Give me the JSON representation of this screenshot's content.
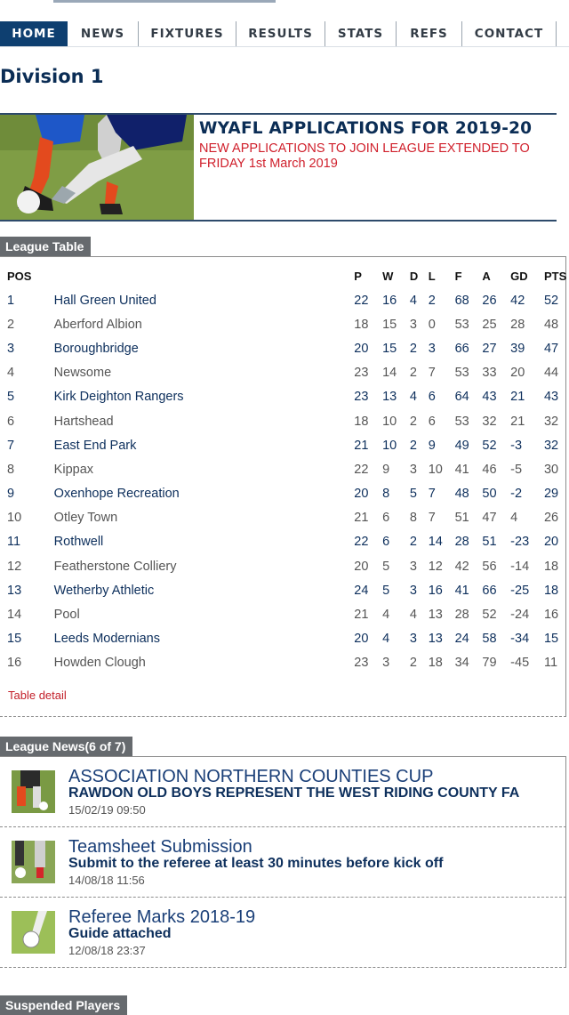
{
  "nav": {
    "items": [
      {
        "label": "HOME",
        "active": true
      },
      {
        "label": "NEWS"
      },
      {
        "label": "FIXTURES"
      },
      {
        "label": "RESULTS"
      },
      {
        "label": "STATS"
      },
      {
        "label": "REFS"
      },
      {
        "label": "CONTACT"
      }
    ]
  },
  "page": {
    "title": "Division 1"
  },
  "banner": {
    "headline": "WYAFL APPLICATIONS FOR 2019-20",
    "subtext": "NEW APPLICATIONS TO JOIN LEAGUE EXTENDED TO FRIDAY 1st March 2019"
  },
  "league_table": {
    "tab_label": "League Table",
    "headers": [
      "POS",
      "",
      "P",
      "W",
      "D",
      "L",
      "F",
      "A",
      "GD",
      "PTS"
    ],
    "rows": [
      [
        "1",
        "Hall Green United",
        "22",
        "16",
        "4",
        "2",
        "68",
        "26",
        "42",
        "52"
      ],
      [
        "2",
        "Aberford Albion",
        "18",
        "15",
        "3",
        "0",
        "53",
        "25",
        "28",
        "48"
      ],
      [
        "3",
        "Boroughbridge",
        "20",
        "15",
        "2",
        "3",
        "66",
        "27",
        "39",
        "47"
      ],
      [
        "4",
        "Newsome",
        "23",
        "14",
        "2",
        "7",
        "53",
        "33",
        "20",
        "44"
      ],
      [
        "5",
        "Kirk Deighton Rangers",
        "23",
        "13",
        "4",
        "6",
        "64",
        "43",
        "21",
        "43"
      ],
      [
        "6",
        "Hartshead",
        "18",
        "10",
        "2",
        "6",
        "53",
        "32",
        "21",
        "32"
      ],
      [
        "7",
        "East End Park",
        "21",
        "10",
        "2",
        "9",
        "49",
        "52",
        "-3",
        "32"
      ],
      [
        "8",
        "Kippax",
        "22",
        "9",
        "3",
        "10",
        "41",
        "46",
        "-5",
        "30"
      ],
      [
        "9",
        "Oxenhope Recreation",
        "20",
        "8",
        "5",
        "7",
        "48",
        "50",
        "-2",
        "29"
      ],
      [
        "10",
        "Otley Town",
        "21",
        "6",
        "8",
        "7",
        "51",
        "47",
        "4",
        "26"
      ],
      [
        "11",
        "Rothwell",
        "22",
        "6",
        "2",
        "14",
        "28",
        "51",
        "-23",
        "20"
      ],
      [
        "12",
        "Featherstone Colliery",
        "20",
        "5",
        "3",
        "12",
        "42",
        "56",
        "-14",
        "18"
      ],
      [
        "13",
        "Wetherby Athletic",
        "24",
        "5",
        "3",
        "16",
        "41",
        "66",
        "-25",
        "18"
      ],
      [
        "14",
        "Pool",
        "21",
        "4",
        "4",
        "13",
        "28",
        "52",
        "-24",
        "16"
      ],
      [
        "15",
        "Leeds Modernians",
        "20",
        "4",
        "3",
        "13",
        "24",
        "58",
        "-34",
        "15"
      ],
      [
        "16",
        "Howden Clough",
        "23",
        "3",
        "2",
        "18",
        "34",
        "79",
        "-45",
        "11"
      ]
    ],
    "detail_link": "Table detail"
  },
  "league_news": {
    "tab_label": "League News(6 of 7)",
    "items": [
      {
        "title": "ASSOCIATION NORTHERN COUNTIES CUP",
        "summary": "RAWDON OLD BOYS REPRESENT THE WEST RIDING COUNTY FA",
        "date": "15/02/19 09:50"
      },
      {
        "title": "Teamsheet Submission",
        "summary": "Submit to the referee at least 30 minutes before kick off",
        "date": "14/08/18 11:56"
      },
      {
        "title": "Referee Marks 2018-19",
        "summary": "Guide attached",
        "date": "12/08/18 23:37"
      }
    ]
  },
  "suspended": {
    "tab_label": "Suspended Players"
  }
}
